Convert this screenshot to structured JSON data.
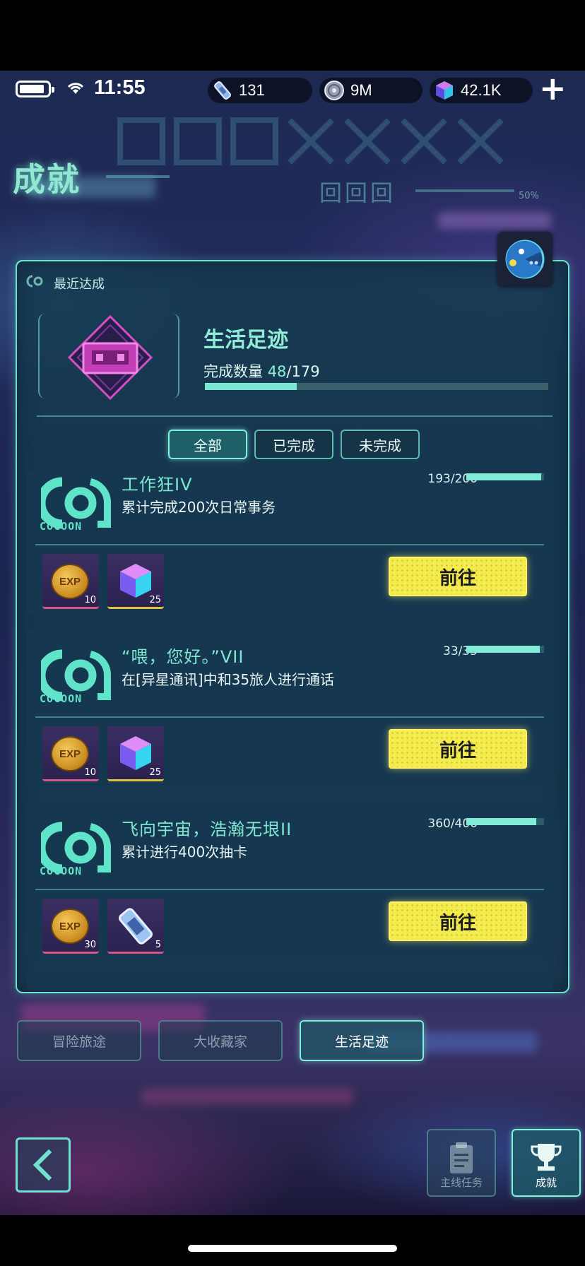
{
  "status_bar": {
    "time": "11:55",
    "currencies": [
      {
        "icon": "ticket-icon",
        "value": "131"
      },
      {
        "icon": "disc-icon",
        "value": "9M"
      },
      {
        "icon": "cube-gem-icon",
        "value": "42.1K"
      }
    ],
    "add_label": "+"
  },
  "header": {
    "title": "成就",
    "deco_chars": "回回回",
    "deco_percent": "50%"
  },
  "recent": {
    "label": "最近达成",
    "category_name": "生活足迹",
    "count_label": "完成数量",
    "count_done": "48",
    "count_total": "/179",
    "progress": 0.268
  },
  "filters": [
    {
      "label": "全部",
      "active": true
    },
    {
      "label": "已完成",
      "active": false
    },
    {
      "label": "未完成",
      "active": false
    }
  ],
  "achievements": [
    {
      "name": "工作狂IV",
      "description": "累计完成200次日常事务",
      "progress_text": "193/200",
      "progress": 0.965,
      "logo_text": "COCOON",
      "rewards": [
        {
          "type": "exp-coin-icon",
          "qty": "10",
          "label": "EXP"
        },
        {
          "type": "cube-gem-icon",
          "qty": "25"
        }
      ],
      "button": "前往"
    },
    {
      "name": "“喂，您好。”VII",
      "description": "在[异星通讯]中和35旅人进行通话",
      "progress_text": "33/35",
      "progress": 0.943,
      "logo_text": "COCOON",
      "rewards": [
        {
          "type": "exp-coin-icon",
          "qty": "10",
          "label": "EXP"
        },
        {
          "type": "cube-gem-icon",
          "qty": "25"
        }
      ],
      "button": "前往"
    },
    {
      "name": "飞向宇宙，浩瀚无垠II",
      "description": "累计进行400次抽卡",
      "progress_text": "360/400",
      "progress": 0.9,
      "logo_text": "COCOON",
      "rewards": [
        {
          "type": "exp-coin-icon",
          "qty": "30",
          "label": "EXP"
        },
        {
          "type": "ticket-icon",
          "qty": "5"
        }
      ],
      "button": "前往"
    }
  ],
  "category_tabs": [
    {
      "label": "冒险旅途",
      "active": false
    },
    {
      "label": "大收藏家",
      "active": false
    },
    {
      "label": "生活足迹",
      "active": true
    }
  ],
  "bottom_nav": [
    {
      "label": "主线任务",
      "icon": "clipboard-icon",
      "active": false
    },
    {
      "label": "成就",
      "icon": "trophy-icon",
      "active": true
    }
  ],
  "colors": {
    "accent": "#6fe1cf",
    "button_yellow": "#f4ec4c",
    "panel_bg": "#163a50"
  }
}
